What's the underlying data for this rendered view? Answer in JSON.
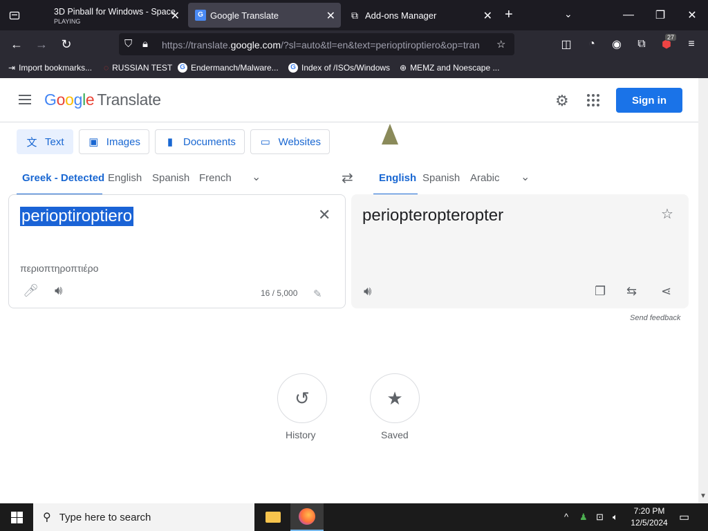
{
  "browser": {
    "tabs": [
      {
        "title": "3D Pinball for Windows - Space",
        "subtitle": "PLAYING",
        "active": false
      },
      {
        "title": "Google Translate",
        "active": true
      },
      {
        "title": "Add-ons Manager",
        "active": false
      }
    ],
    "url_prefix": "https://translate.",
    "url_domain": "google.com",
    "url_suffix": "/?sl=auto&tl=en&text=perioptiroptiero&op=tran",
    "extension_badge": "27",
    "bookmarks": [
      "Import bookmarks...",
      "RUSSIAN TEST",
      "Endermanch/Malware...",
      "Index of /ISOs/Windows",
      "MEMZ and Noescape ..."
    ]
  },
  "header": {
    "logo_letters": [
      "G",
      "o",
      "o",
      "g",
      "l",
      "e"
    ],
    "product": "Translate",
    "signin_label": "Sign in"
  },
  "modes": [
    {
      "label": "Text",
      "icon": "translate-icon"
    },
    {
      "label": "Images",
      "icon": "image-icon"
    },
    {
      "label": "Documents",
      "icon": "document-icon"
    },
    {
      "label": "Websites",
      "icon": "website-icon"
    }
  ],
  "source_langs": [
    "Greek - Detected",
    "English",
    "Spanish",
    "French"
  ],
  "target_langs": [
    "English",
    "Spanish",
    "Arabic"
  ],
  "source": {
    "text": "perioptiroptiero",
    "transliteration": "περιοπτηροπτιέρο",
    "char_count": "16 / 5,000"
  },
  "target": {
    "text": "periopteropteropter"
  },
  "feedback_label": "Send feedback",
  "history_label": "History",
  "saved_label": "Saved",
  "taskbar": {
    "search_placeholder": "Type here to search",
    "time": "7:20 PM",
    "date": "12/5/2024"
  }
}
